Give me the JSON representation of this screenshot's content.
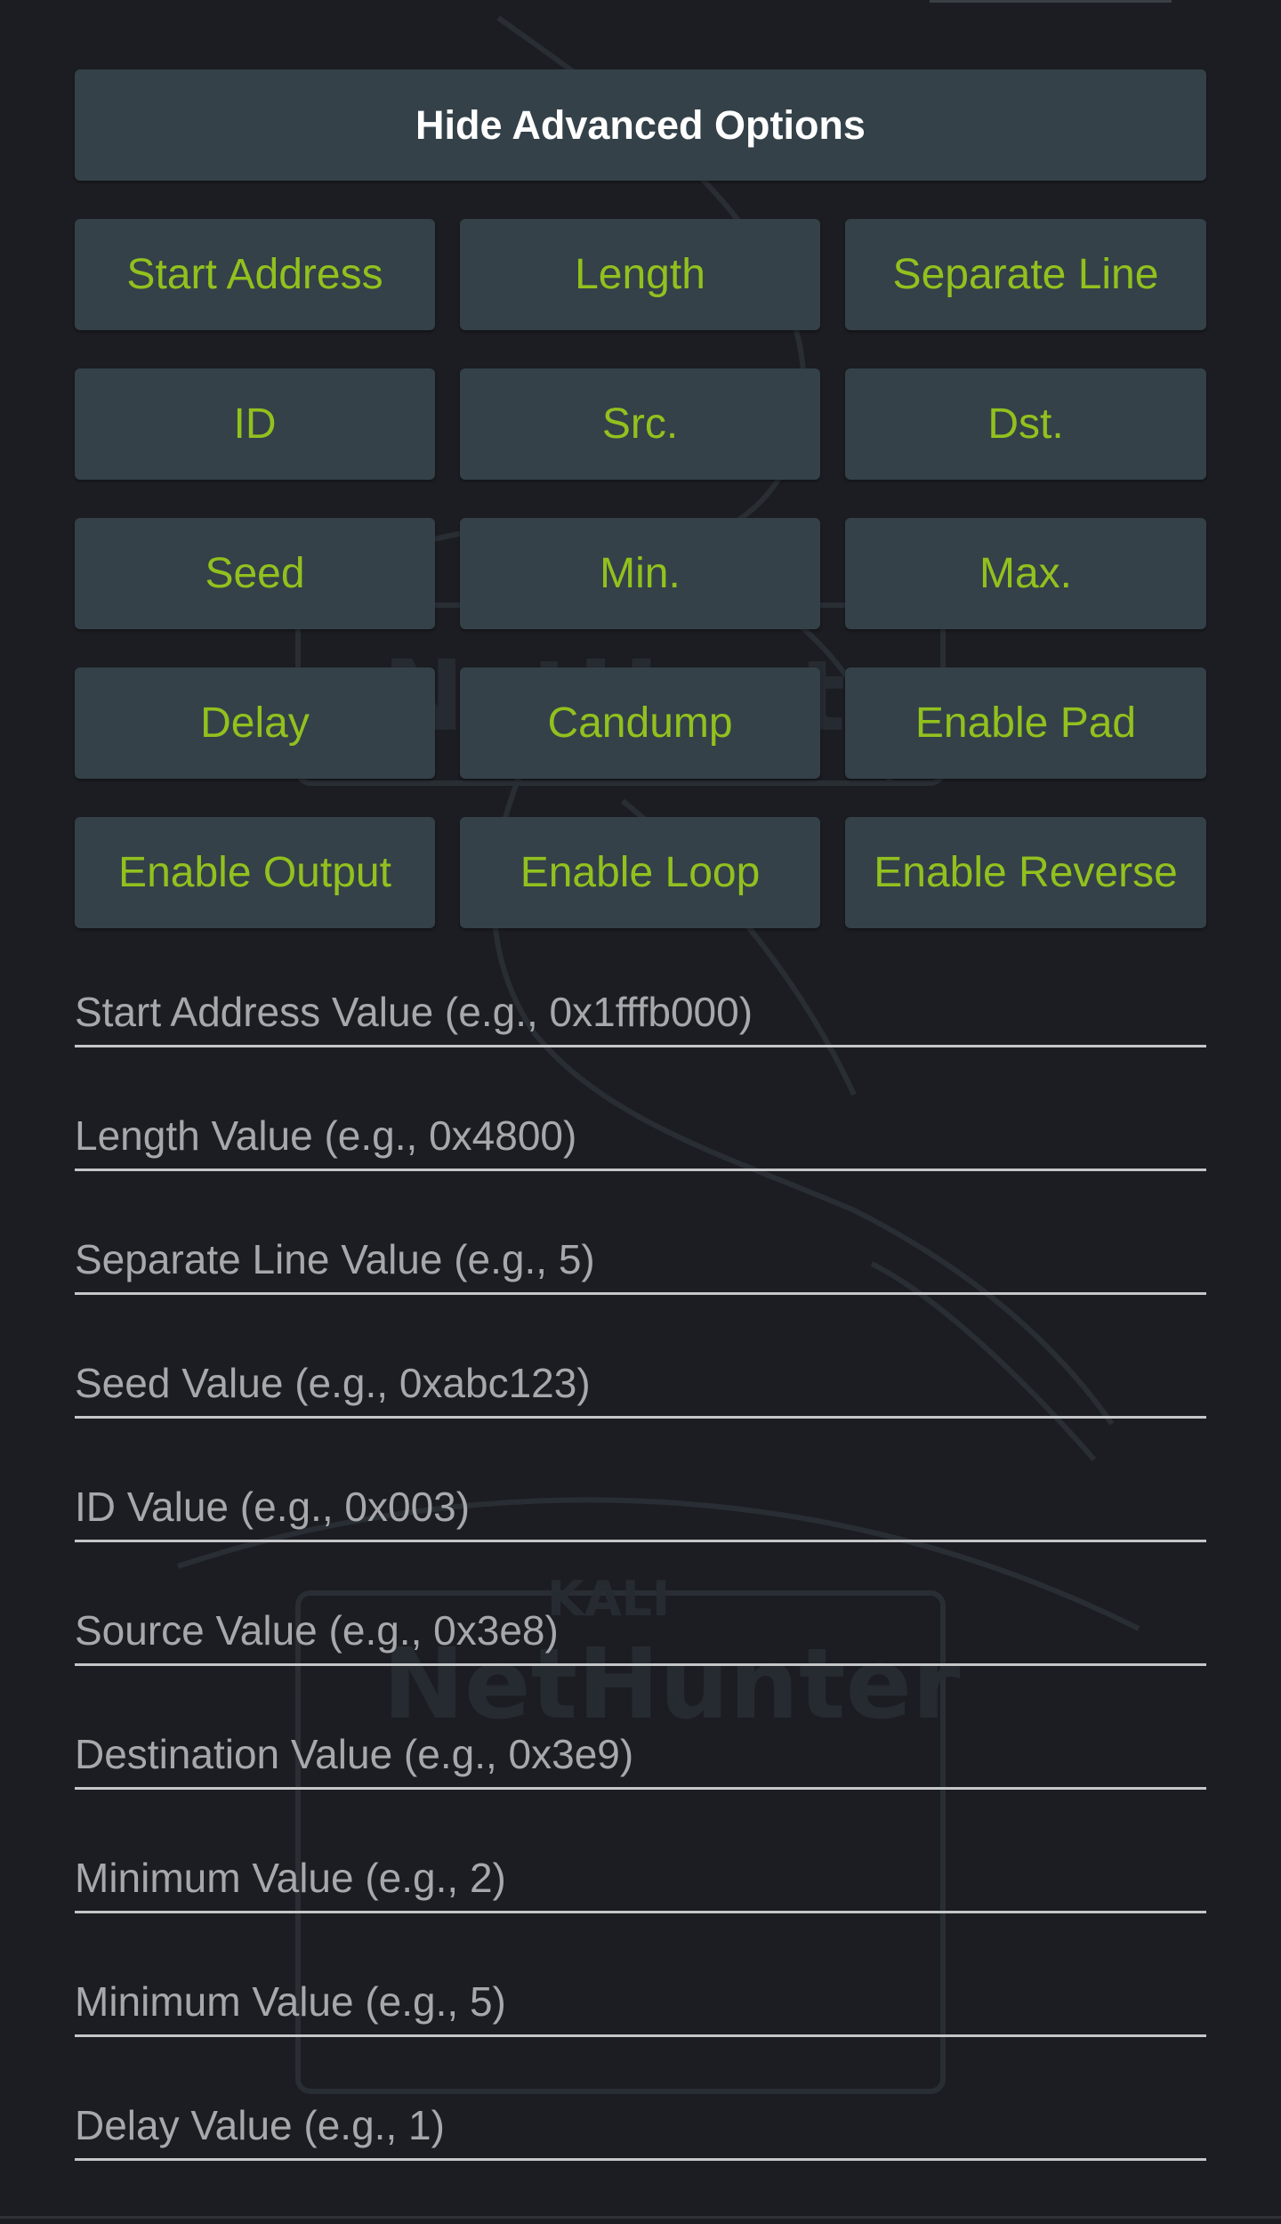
{
  "toggle_button_label": "Hide Advanced Options",
  "option_buttons": [
    "Start Address",
    "Length",
    "Separate Line",
    "ID",
    "Src.",
    "Dst.",
    "Seed",
    "Min.",
    "Max.",
    "Delay",
    "Candump",
    "Enable Pad",
    "Enable Output",
    "Enable Loop",
    "Enable Reverse"
  ],
  "fields": [
    {
      "placeholder": "Start Address Value (e.g., 0x1fffb000)",
      "value": ""
    },
    {
      "placeholder": "Length Value (e.g., 0x4800)",
      "value": ""
    },
    {
      "placeholder": "Separate Line Value (e.g., 5)",
      "value": ""
    },
    {
      "placeholder": "Seed Value (e.g., 0xabc123)",
      "value": ""
    },
    {
      "placeholder": "ID Value (e.g., 0x003)",
      "value": ""
    },
    {
      "placeholder": "Source Value (e.g., 0x3e8)",
      "value": ""
    },
    {
      "placeholder": "Destination Value (e.g., 0x3e9)",
      "value": ""
    },
    {
      "placeholder": "Minimum Value (e.g., 2)",
      "value": ""
    },
    {
      "placeholder": "Minimum Value (e.g., 5)",
      "value": ""
    },
    {
      "placeholder": "Delay Value (e.g., 1)",
      "value": ""
    }
  ],
  "watermark": {
    "brand_top": "KALI",
    "brand_bottom": "NetHunter"
  },
  "colors": {
    "background": "#1c1d22",
    "button_bg": "#344148",
    "button_text_accent": "#92c11e",
    "button_text_primary": "#ffffff",
    "field_underline": "#c4c6c8",
    "placeholder": "#a6a8ab"
  }
}
